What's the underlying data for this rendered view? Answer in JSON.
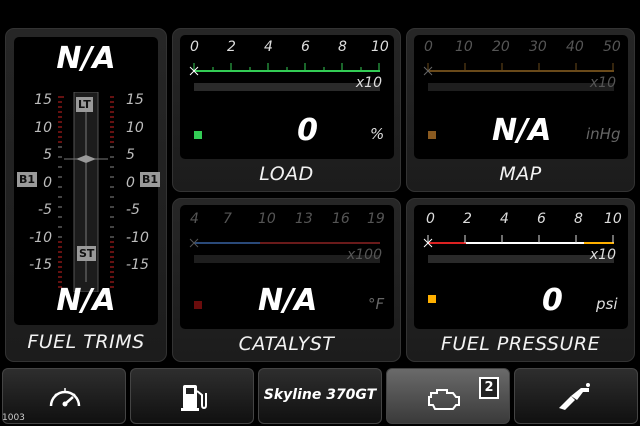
{
  "fuel_trims": {
    "top_value": "N/A",
    "bottom_value": "N/A",
    "caption": "FUEL TRIMS",
    "scale": [
      "15",
      "10",
      "5",
      "0",
      "-5",
      "-10",
      "-15"
    ],
    "lt_label": "LT",
    "st_label": "ST",
    "bank_left": "B1",
    "bank_right": "B1"
  },
  "load": {
    "ticks": [
      "0",
      "2",
      "4",
      "6",
      "8",
      "10"
    ],
    "multiplier": "x10",
    "value": "0",
    "unit": "%",
    "caption": "LOAD",
    "color": "#33cc55"
  },
  "map": {
    "ticks": [
      "0",
      "10",
      "20",
      "30",
      "40",
      "50"
    ],
    "multiplier": "x10",
    "value": "N/A",
    "unit": "inHg",
    "caption": "MAP",
    "color": "#8a5a20"
  },
  "catalyst": {
    "ticks": [
      "4",
      "7",
      "10",
      "13",
      "16",
      "19"
    ],
    "multiplier": "x100",
    "value": "N/A",
    "unit": "°F",
    "caption": "CATALYST",
    "color": "#7a1010"
  },
  "fuel_pressure": {
    "ticks": [
      "0",
      "2",
      "4",
      "6",
      "8",
      "10"
    ],
    "multiplier": "x10",
    "value": "0",
    "unit": "psi",
    "caption": "FUEL PRESSURE",
    "color": "#ffb000"
  },
  "tabs": {
    "vehicle_label": "Skyline 370GT",
    "engine_badge": "2"
  },
  "corner_label": "1003"
}
